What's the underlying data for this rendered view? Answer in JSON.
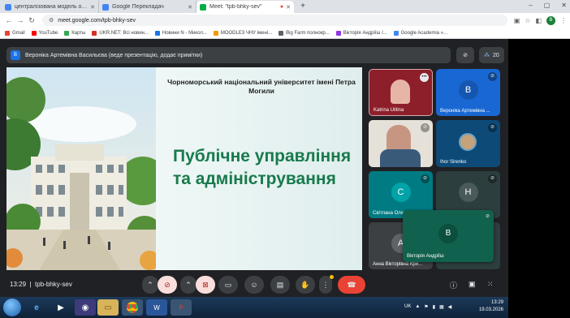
{
  "browser": {
    "tabs": [
      {
        "label": "централізована модель охоро",
        "color": "#4285f4"
      },
      {
        "label": "Google Перекладач",
        "color": "#4285f4"
      },
      {
        "label": "Meet: \"tpb-bhky-sev\"",
        "color": "#00ac47"
      }
    ],
    "new_tab": "+",
    "url": "meet.google.com/tpb-bhky-sev",
    "profile_initial": "B",
    "bookmarks": [
      {
        "label": "Gmail",
        "color": "#ea4335"
      },
      {
        "label": "YouTube",
        "color": "#ff0000"
      },
      {
        "label": "Карты",
        "color": "#34a853"
      },
      {
        "label": "UKR.NET: Всі новин...",
        "color": "#d93025"
      },
      {
        "label": "Новини N - Микол...",
        "color": "#1a73e8"
      },
      {
        "label": "MOODLE3 ЧНУ імені...",
        "color": "#f29900"
      },
      {
        "label": "Big Farm полнокр...",
        "color": "#5f6368"
      },
      {
        "label": "Вікторія Андріїш /...",
        "color": "#9334e6"
      },
      {
        "label": "Google Academia »...",
        "color": "#4285f4"
      }
    ]
  },
  "meet": {
    "presenter_initial": "B",
    "presenter_text": "Вероніка Артемівна Васильєва (веде презентацію, додає примітки)",
    "participant_count": "20",
    "slide": {
      "university": "Чорноморський національний університет імені Петра Могили",
      "title": "Публічне управління та адміністрування"
    },
    "tiles": [
      {
        "name": "Katrina Ulitina",
        "initial": "",
        "bg": "#8d1f2a",
        "kind": "photo"
      },
      {
        "name": "Вероніка Артемівна ...",
        "initial": "B",
        "bg": "#1967d2",
        "kind": "avatar"
      },
      {
        "name": "",
        "initial": "",
        "bg": "#e6e1d8",
        "kind": "video"
      },
      {
        "name": "Ihor Sirenko",
        "initial": "",
        "bg": "#0d4a78",
        "kind": "photo"
      },
      {
        "name": "Світлана Оле...",
        "initial": "C",
        "bg": "#007b83",
        "kind": "avatar"
      },
      {
        "name": "",
        "initial": "H",
        "bg": "#2d3e3f",
        "kind": "avatar"
      },
      {
        "name": "Анна Вікторівна Кри...",
        "initial": "A",
        "bg": "#3c4043",
        "kind": "avatar"
      },
      {
        "name": "",
        "initial": "",
        "bg": "#2d3e3f",
        "kind": "avatar"
      }
    ],
    "floating_tile": {
      "name": "Вікторія Андріїш",
      "initial": "B"
    },
    "time": "13:29",
    "meeting_code": "tpb-bhky-sev"
  },
  "taskbar": {
    "lang": "UK",
    "time": "13:29",
    "date": "19.03.2026"
  }
}
